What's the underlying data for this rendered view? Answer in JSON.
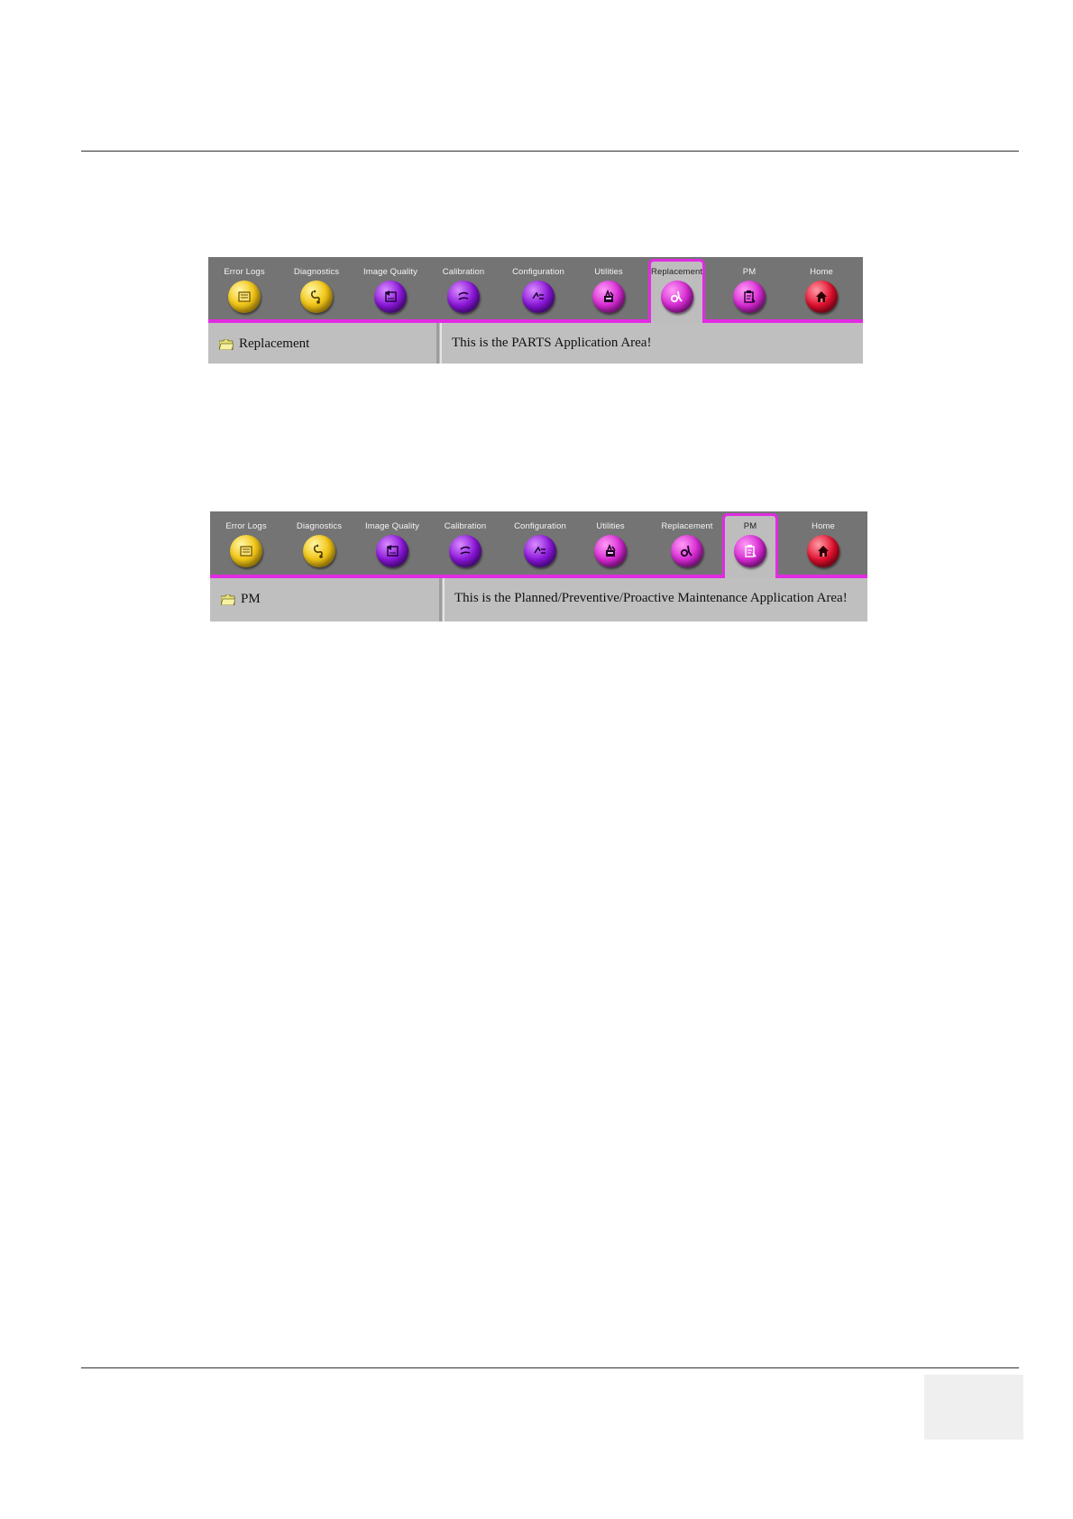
{
  "toolbar_items": [
    {
      "label": "Error Logs",
      "icon": "error-log-icon",
      "color": "yellow"
    },
    {
      "label": "Diagnostics",
      "icon": "stethoscope-icon",
      "color": "yellow"
    },
    {
      "label": "Image Quality",
      "icon": "image-quality-icon",
      "color": "purple"
    },
    {
      "label": "Calibration",
      "icon": "calibration-icon",
      "color": "purple"
    },
    {
      "label": "Configuration",
      "icon": "configuration-icon",
      "color": "purple"
    },
    {
      "label": "Utilities",
      "icon": "utilities-icon",
      "color": "magenta"
    },
    {
      "label": "Replacement",
      "icon": "replacement-icon",
      "color": "magenta"
    },
    {
      "label": "PM",
      "icon": "pm-clipboard-icon",
      "color": "magenta"
    },
    {
      "label": "Home",
      "icon": "home-icon",
      "color": "red"
    }
  ],
  "screens": [
    {
      "active": "Replacement",
      "folder_label": "Replacement",
      "message": "This is the PARTS Application Area!"
    },
    {
      "active": "PM",
      "folder_label": "PM",
      "message": "This is the Planned/Preventive/Proactive Maintenance Application Area!"
    }
  ],
  "colors": {
    "accent": "#e22be2",
    "toolbar": "#747474",
    "panel": "#c0bfc0"
  }
}
